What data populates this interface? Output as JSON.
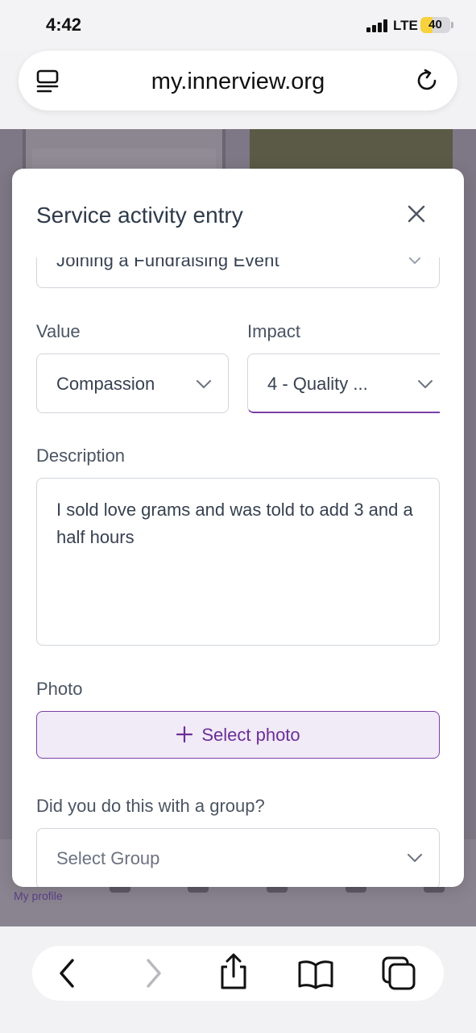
{
  "status_bar": {
    "time": "4:42",
    "network": "LTE",
    "battery": "40",
    "battery_level_percent": 40,
    "battery_color": "#f7d23e"
  },
  "browser": {
    "url": "my.innerview.org"
  },
  "background_page": {
    "active_tab_label": "My profile"
  },
  "modal": {
    "title": "Service activity entry",
    "activity_value": "Joining a Fundraising Event",
    "value_label": "Value",
    "value_selected": "Compassion",
    "impact_label": "Impact",
    "impact_selected": "4 - Quality ...",
    "description_label": "Description",
    "description_text": "I sold love grams and was told to add 3 and a half hours",
    "photo_label": "Photo",
    "select_photo_button": "Select photo",
    "group_question": "Did you do this with a group?",
    "group_placeholder": "Select Group"
  },
  "colors": {
    "accent": "#7b3fa6",
    "photo_button_bg": "#f1eaf7",
    "title_text": "#2f3a4a"
  },
  "icons": [
    "reader-icon",
    "reload-icon",
    "close-icon",
    "chevron-down-icon",
    "plus-icon",
    "back-icon",
    "forward-icon",
    "share-icon",
    "bookmarks-icon",
    "tabs-icon"
  ]
}
